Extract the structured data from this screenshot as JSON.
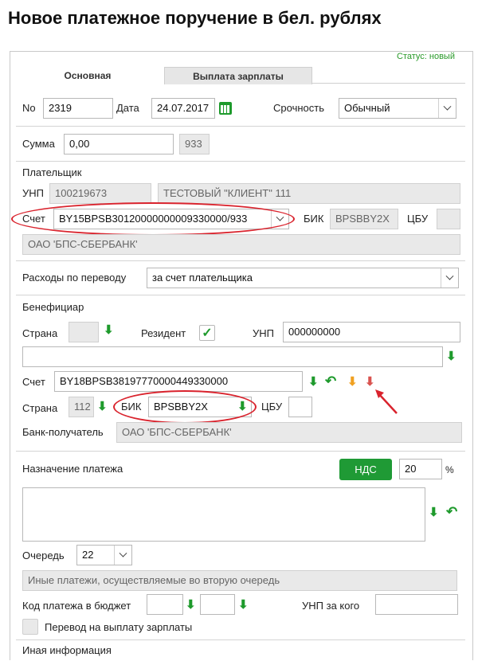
{
  "page": {
    "title": "Новое платежное поручение в бел. рублях",
    "status": "Статус: новый"
  },
  "tabs": [
    {
      "label": "Основная"
    },
    {
      "label": "Выплата зарплаты"
    }
  ],
  "header": {
    "no_label": "No",
    "no_value": "2319",
    "date_label": "Дата",
    "date_value": "24.07.2017",
    "urgency_label": "Срочность",
    "urgency_value": "Обычный"
  },
  "amount": {
    "label": "Сумма",
    "value": "0,00",
    "currency": "933"
  },
  "payer": {
    "section_label": "Плательщик",
    "unp_label": "УНП",
    "unp_value": "100219673",
    "name_value": "ТЕСТОВЫЙ \"КЛИЕНТ\" 111",
    "account_label": "Счет",
    "account_value": "BY15BPSB30120000000009330000/933",
    "bik_label": "БИК",
    "bik_value": "BPSBBY2X",
    "cbu_label": "ЦБУ",
    "cbu_value": "",
    "bank_value": "ОАО 'БПС-СБЕРБАНК'"
  },
  "expenses": {
    "label": "Расходы по переводу",
    "value": "за счет плательщика"
  },
  "beneficiary": {
    "section_label": "Бенефициар",
    "country_label": "Страна",
    "country_value": "",
    "resident_label": "Резидент",
    "resident_checked": true,
    "unp_label": "УНП",
    "unp_value": "000000000",
    "name_value": "",
    "account_label": "Счет",
    "account_value": "BY18BPSB38197770000449330000",
    "country2_label": "Страна",
    "country2_value": "112",
    "bik_label": "БИК",
    "bik_value": "BPSBBY2X",
    "cbu_label": "ЦБУ",
    "cbu_value": "",
    "bank_label": "Банк-получатель",
    "bank_value": "ОАО 'БПС-СБЕРБАНК'"
  },
  "purpose": {
    "label": "Назначение платежа",
    "nds_button": "НДС",
    "nds_value": "20",
    "percent": "%",
    "text": "",
    "queue_label": "Очередь",
    "queue_value": "22",
    "queue_desc": "Иные платежи, осуществляемые во вторую очередь",
    "budget_label": "Код платежа в бюджет",
    "budget_value1": "",
    "budget_value2": "",
    "unp_for_label": "УНП за кого",
    "unp_for_value": "",
    "salary_label": "Перевод на выплату зарплаты"
  },
  "other": {
    "label": "Иная информация"
  },
  "colors": {
    "accent": "#1f9a35",
    "highlight": "#d9232d",
    "status": "#2a9a2a"
  },
  "icons": [
    "calendar-icon",
    "chevron-down-icon",
    "arrow-down-icon",
    "undo-arrow-icon",
    "checkmark-icon",
    "pointer-arrow-icon"
  ]
}
